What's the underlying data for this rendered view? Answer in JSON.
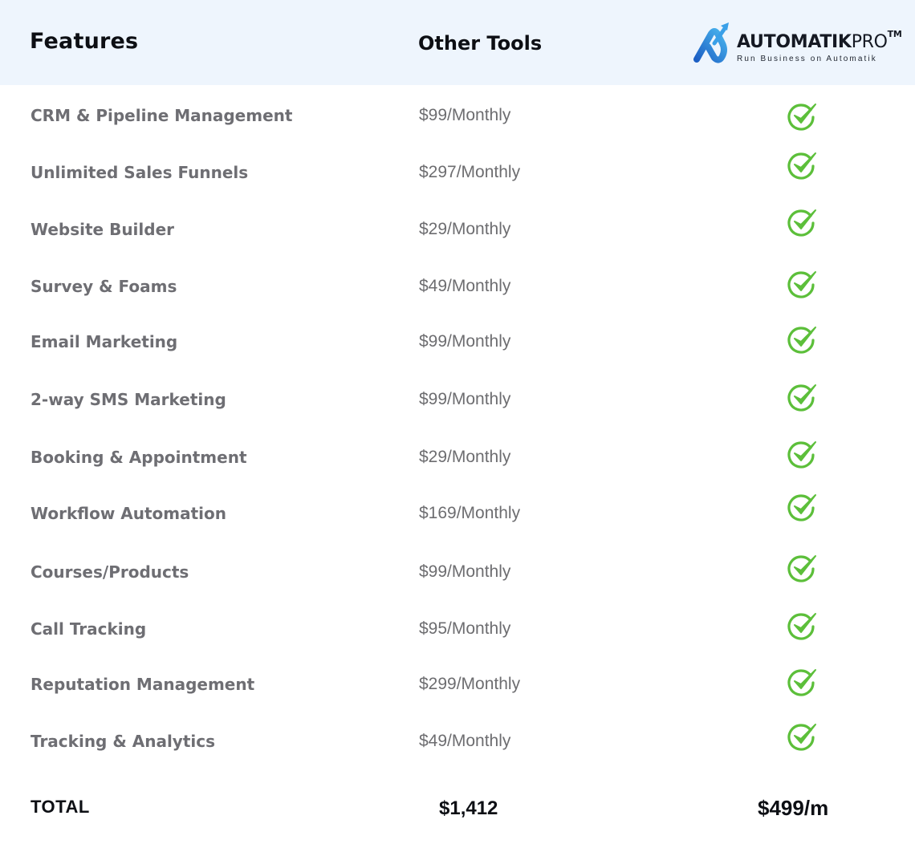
{
  "header": {
    "features_label": "Features",
    "other_tools_label": "Other Tools",
    "brand": {
      "name_bold": "AUTOMATIK",
      "name_light": "PRO",
      "trademark": "TM",
      "tagline": "Run Business on Automatik",
      "logo_icon": "upward-arrow-loop-logo-icon"
    }
  },
  "colors": {
    "header_bg": "#eef5fd",
    "check_green": "#5cbf3a",
    "brand_blue": "#2f7fd6",
    "text_dark": "#0d0f14",
    "text_gray": "#6e6e73"
  },
  "rows": [
    {
      "feature": "CRM & Pipeline Management",
      "other_price": "$99/Monthly",
      "included_icon": "check-circle-icon"
    },
    {
      "feature": "Unlimited Sales Funnels",
      "other_price": "$297/Monthly",
      "included_icon": "check-circle-icon"
    },
    {
      "feature": "Website Builder",
      "other_price": "$29/Monthly",
      "included_icon": "check-circle-icon"
    },
    {
      "feature": "Survey & Foams",
      "other_price": "$49/Monthly",
      "included_icon": "check-circle-icon"
    },
    {
      "feature": "Email Marketing",
      "other_price": "$99/Monthly",
      "included_icon": "check-circle-icon"
    },
    {
      "feature": "2-way SMS Marketing",
      "other_price": "$99/Monthly",
      "included_icon": "check-circle-icon"
    },
    {
      "feature": "Booking & Appointment",
      "other_price": "$29/Monthly",
      "included_icon": "check-circle-icon"
    },
    {
      "feature": "Workflow Automation",
      "other_price": "$169/Monthly",
      "included_icon": "check-circle-icon"
    },
    {
      "feature": "Courses/Products",
      "other_price": "$99/Monthly",
      "included_icon": "check-circle-icon"
    },
    {
      "feature": "Call Tracking",
      "other_price": "$95/Monthly",
      "included_icon": "check-circle-icon"
    },
    {
      "feature": "Reputation Management",
      "other_price": "$299/Monthly",
      "included_icon": "check-circle-icon"
    },
    {
      "feature": "Tracking & Analytics",
      "other_price": "$49/Monthly",
      "included_icon": "check-circle-icon"
    }
  ],
  "total": {
    "label": "TOTAL",
    "other_tools": "$1,412",
    "automatik_pro": "$499/m"
  }
}
